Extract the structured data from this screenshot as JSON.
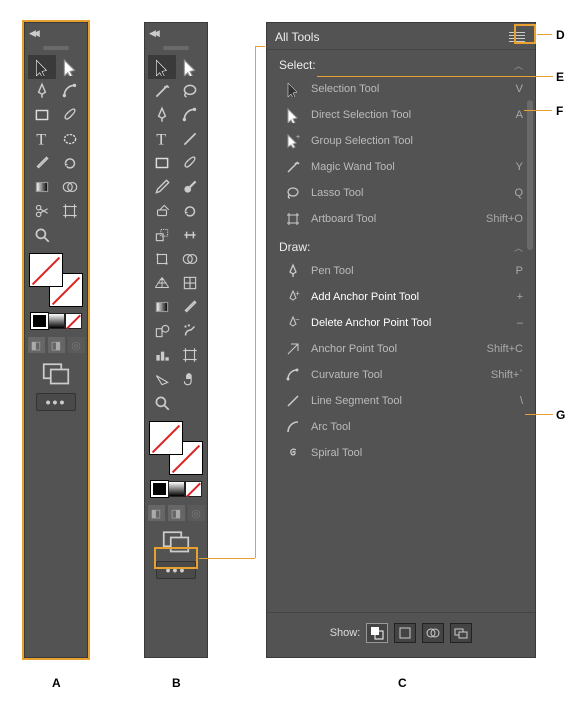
{
  "labels": {
    "A": "A",
    "B": "B",
    "C": "C",
    "D": "D",
    "E": "E",
    "F": "F",
    "G": "G"
  },
  "toolbarA": {
    "tools": [
      "selection",
      "direct-selection",
      "pen",
      "curvature",
      "rectangle",
      "paintbrush",
      "type",
      "ellipse",
      "eyedropper",
      "rotate",
      "gradient",
      "shape-builder",
      "scissors",
      "artboard",
      "zoom"
    ]
  },
  "toolbarB": {
    "tools": [
      "selection",
      "direct-selection",
      "magic-wand",
      "lasso",
      "pen",
      "curvature",
      "type",
      "line-segment",
      "rectangle",
      "paintbrush",
      "pencil",
      "blob-brush",
      "eraser",
      "rotate",
      "scale",
      "width",
      "free-transform",
      "shape-builder",
      "perspective-grid",
      "mesh",
      "gradient",
      "eyedropper",
      "blend",
      "symbol-sprayer",
      "column-graph",
      "artboard",
      "slice",
      "hand",
      "zoom"
    ]
  },
  "allTools": {
    "title": "All Tools",
    "groups": [
      {
        "name": "Select:",
        "items": [
          {
            "icon": "selection",
            "label": "Selection Tool",
            "shortcut": "V"
          },
          {
            "icon": "direct-selection",
            "label": "Direct Selection Tool",
            "shortcut": "A"
          },
          {
            "icon": "group-selection",
            "label": "Group Selection Tool",
            "shortcut": ""
          },
          {
            "icon": "magic-wand",
            "label": "Magic Wand Tool",
            "shortcut": "Y"
          },
          {
            "icon": "lasso",
            "label": "Lasso Tool",
            "shortcut": "Q"
          },
          {
            "icon": "artboard",
            "label": "Artboard Tool",
            "shortcut": "Shift+O"
          }
        ]
      },
      {
        "name": "Draw:",
        "items": [
          {
            "icon": "pen",
            "label": "Pen Tool",
            "shortcut": "P"
          },
          {
            "icon": "add-anchor",
            "label": "Add Anchor Point Tool",
            "shortcut": "+",
            "available": true
          },
          {
            "icon": "delete-anchor",
            "label": "Delete Anchor Point Tool",
            "shortcut": "–",
            "available": true
          },
          {
            "icon": "anchor-point",
            "label": "Anchor Point Tool",
            "shortcut": "Shift+C"
          },
          {
            "icon": "curvature",
            "label": "Curvature Tool",
            "shortcut": "Shift+`"
          },
          {
            "icon": "line-segment",
            "label": "Line Segment Tool",
            "shortcut": "\\"
          },
          {
            "icon": "arc",
            "label": "Arc Tool",
            "shortcut": ""
          },
          {
            "icon": "spiral",
            "label": "Spiral Tool",
            "shortcut": ""
          }
        ]
      }
    ],
    "showLabel": "Show:"
  }
}
